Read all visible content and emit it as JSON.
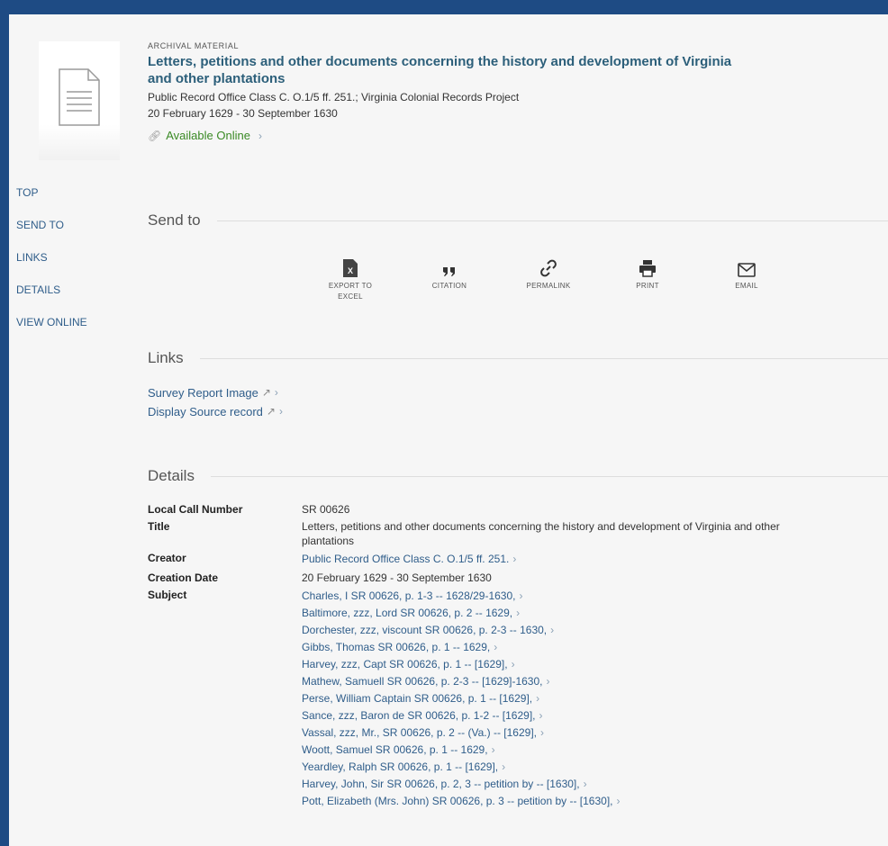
{
  "record": {
    "type": "ARCHIVAL MATERIAL",
    "title_line1": "Letters, petitions and other documents concerning the history and development of Virginia",
    "title_line2": "and other plantations",
    "creator_line": "Public Record Office Class C. O.1/5 ff. 251.; Virginia Colonial Records Project",
    "date_line": "20 February 1629 - 30 September 1630",
    "availability": "Available Online"
  },
  "sidenav": [
    "TOP",
    "SEND TO",
    "LINKS",
    "DETAILS",
    "VIEW ONLINE"
  ],
  "sections": {
    "send_to": "Send to",
    "links": "Links",
    "details": "Details"
  },
  "send_actions": [
    {
      "icon": "excel-icon",
      "label_line1": "EXPORT TO",
      "label_line2": "EXCEL"
    },
    {
      "icon": "quote-icon",
      "label_line1": "CITATION",
      "label_line2": ""
    },
    {
      "icon": "link-icon",
      "label_line1": "PERMALINK",
      "label_line2": ""
    },
    {
      "icon": "print-icon",
      "label_line1": "PRINT",
      "label_line2": ""
    },
    {
      "icon": "mail-icon",
      "label_line1": "EMAIL",
      "label_line2": ""
    }
  ],
  "links": [
    "Survey Report Image",
    "Display Source record"
  ],
  "details": {
    "call_number_label": "Local Call Number",
    "call_number": "SR 00626",
    "title_label": "Title",
    "title_line1": "Letters, petitions and other documents concerning the history and development of Virginia and other",
    "title_line2": "plantations",
    "creator_label": "Creator",
    "creator": "Public Record Office Class C. O.1/5 ff. 251.",
    "creation_date_label": "Creation Date",
    "creation_date": "20 February 1629 - 30 September 1630",
    "subject_label": "Subject",
    "subjects": [
      "Charles, I SR 00626, p. 1-3 -- 1628/29-1630,",
      "Baltimore, zzz, Lord SR 00626, p. 2 -- 1629,",
      "Dorchester, zzz, viscount SR 00626, p. 2-3 -- 1630,",
      "Gibbs, Thomas SR 00626, p. 1 -- 1629,",
      "Harvey, zzz, Capt SR 00626, p. 1 -- [1629],",
      "Mathew, Samuell SR 00626, p. 2-3 -- [1629]-1630,",
      "Perse, William Captain SR 00626, p. 1 -- [1629],",
      "Sance, zzz, Baron de SR 00626, p. 1-2 -- [1629],",
      "Vassal, zzz, Mr., SR 00626, p. 2 -- (Va.) -- [1629],",
      "Woott, Samuel SR 00626, p. 1 -- 1629,",
      "Yeardley, Ralph SR 00626, p. 1 -- [1629],",
      "Harvey, John, Sir SR 00626, p. 2, 3 -- petition by -- [1630],",
      "Pott, Elizabeth (Mrs. John) SR 00626, p. 3 -- petition by -- [1630],"
    ]
  },
  "colors": {
    "frame": "#1e4b84",
    "title": "#2c5f7a",
    "link": "#2f5d8a",
    "available": "#3a8a25"
  }
}
